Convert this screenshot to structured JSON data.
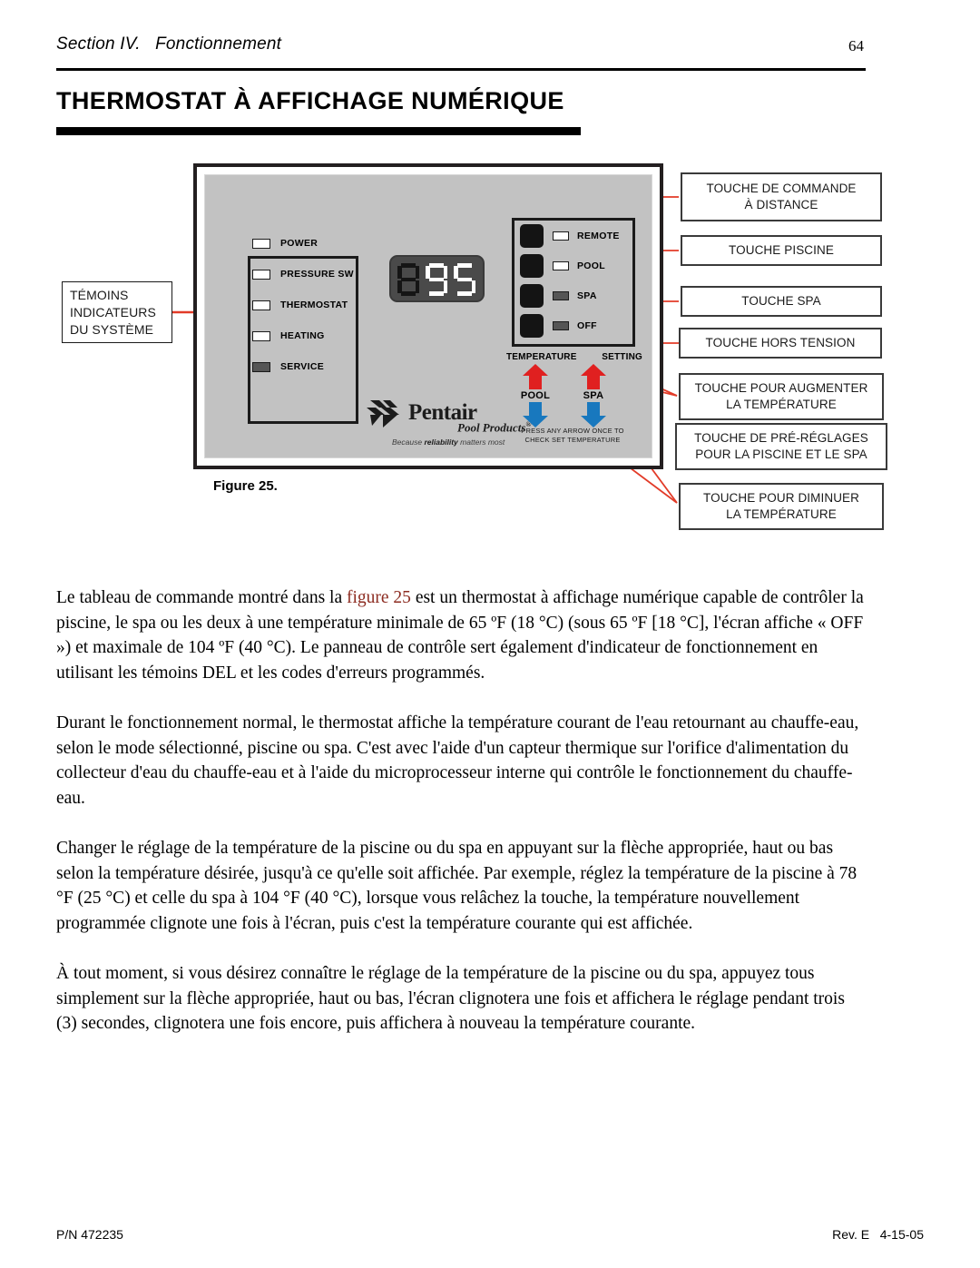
{
  "header": {
    "section": "Section IV.   Fonctionnement",
    "page_number": "64"
  },
  "title": "THERMOSTAT À AFFICHAGE NUMÉRIQUE",
  "figure": {
    "caption": "Figure 25.",
    "display": {
      "digits": [
        "8",
        "9",
        "5"
      ],
      "lit": [
        false,
        true,
        true
      ],
      "value": "95"
    },
    "system_indicators_callout": "TÉMOINS\nINDICATEURS\nDU SYSTÈME",
    "leds": [
      {
        "label": "POWER",
        "state": "on"
      },
      {
        "label": "PRESSURE SW",
        "state": "on"
      },
      {
        "label": "THERMOSTAT",
        "state": "on"
      },
      {
        "label": "HEATING",
        "state": "on"
      },
      {
        "label": "SERVICE",
        "state": "off"
      }
    ],
    "buttons": [
      {
        "label": "REMOTE",
        "state": "on"
      },
      {
        "label": "POOL",
        "state": "on"
      },
      {
        "label": "SPA",
        "state": "off"
      },
      {
        "label": "OFF",
        "state": "off"
      }
    ],
    "temperature_header_left": "TEMPERATURE",
    "temperature_header_right": "SETTING",
    "arrow_columns": [
      {
        "label": "POOL"
      },
      {
        "label": "SPA"
      }
    ],
    "press_note_line1": "PRESS ANY ARROW ONCE TO",
    "press_note_line2": "CHECK SET TEMPERATURE",
    "logo": {
      "wordmark": "Pentair",
      "subtitle": "Pool Products",
      "registered": "®",
      "tagline_pre": "Because ",
      "tagline_bold": "reliability",
      "tagline_post": " matters most"
    },
    "callouts": {
      "remote": "TOUCHE DE COMMANDE\nÀ DISTANCE",
      "pool": "TOUCHE PISCINE",
      "spa": "TOUCHE SPA",
      "off": "TOUCHE HORS TENSION",
      "temp_up": "TOUCHE POUR AUGMENTER\nLA TEMPÉRATURE",
      "preset": "TOUCHE DE PRÉ-RÉGLAGES\nPOUR LA PISCINE ET LE SPA",
      "temp_down": "TOUCHE POUR DIMINUER\nLA TEMPÉRATURE"
    },
    "colors": {
      "arrow_up": "#e02020",
      "arrow_down": "#1878be",
      "leader_line": "#e23b28",
      "panel_face": "#c2c2c2"
    }
  },
  "body": {
    "p1_before_ref": "Le tableau de commande montré dans la ",
    "p1_ref": "figure 25",
    "p1_after_ref": " est un thermostat à affichage numérique capable de contrôler la piscine, le spa ou les deux à une température minimale de 65 ºF (18 °C) (sous 65 ºF [18 °C], l'écran affiche « OFF ») et maximale de 104 ºF (40 °C). Le panneau de contrôle sert également d'indicateur de fonctionnement en utilisant les témoins DEL et les codes d'erreurs programmés.",
    "p2": "Durant le fonctionnement normal, le thermostat affiche la température courant de l'eau retournant au chauffe-eau, selon le mode sélectionné, piscine ou spa. C'est avec l'aide d'un capteur thermique sur l'orifice d'alimentation du collecteur d'eau du chauffe-eau et à l'aide du microprocesseur interne qui contrôle le fonctionnement du chauffe-eau.",
    "p3": "Changer le réglage de la température de la piscine ou du spa en appuyant sur la flèche appropriée, haut ou bas selon la température désirée, jusqu'à ce qu'elle soit affichée. Par exemple, réglez la température de la piscine à 78 °F (25 °C) et celle du spa à 104 °F (40 °C), lorsque vous relâchez la touche, la température nouvellement programmée clignote une fois à l'écran, puis c'est la température courante qui est affichée.",
    "p4": "À tout moment, si vous désirez connaître le réglage de la température de la piscine ou du spa, appuyez tous simplement sur la flèche appropriée, haut ou bas, l'écran clignotera une fois et affichera le réglage pendant trois (3) secondes, clignotera une fois encore, puis affichera à nouveau la température courante."
  },
  "footer": {
    "part_number": "P/N  472235",
    "revision": "Rev. E   4-15-05"
  }
}
